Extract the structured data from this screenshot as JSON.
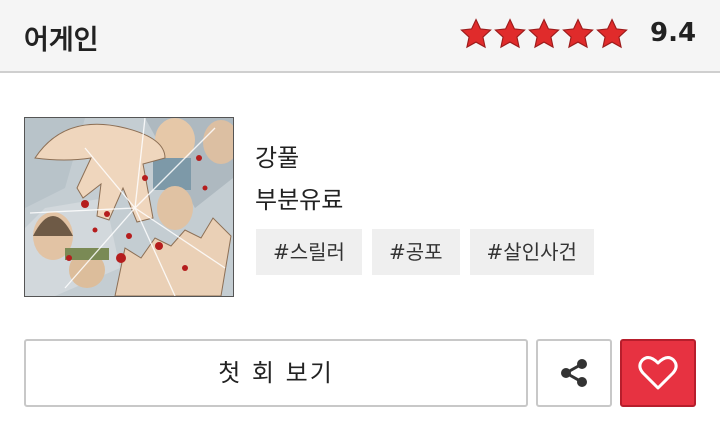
{
  "header": {
    "title": "어게인",
    "rating": "9.4",
    "star_count": 5,
    "star_color": "#e02b2b"
  },
  "thumbnail": {
    "description": "comic cover art"
  },
  "info": {
    "author": "강풀",
    "price_status": "부분유료",
    "tags": [
      "#스릴러",
      "#공포",
      "#살인사건"
    ]
  },
  "actions": {
    "first_episode_label": "첫 회 보기",
    "share_icon": "share-icon",
    "like_icon": "heart-icon",
    "like_color": "#e73241"
  }
}
